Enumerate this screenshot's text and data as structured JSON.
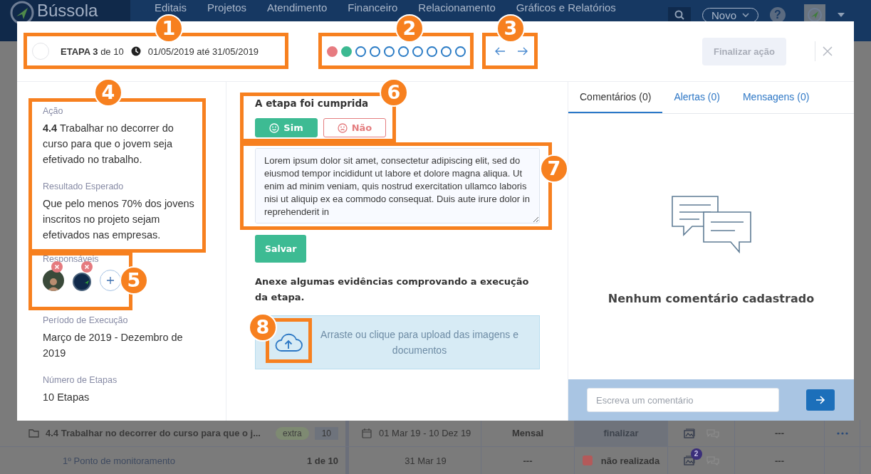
{
  "app": {
    "logo": "Bússola",
    "nav": [
      "Editais",
      "Projetos",
      "Atendimento",
      "Financeiro",
      "Relacionamento",
      "Gráficos e Relatórios"
    ],
    "new_button": "Novo",
    "help": "?"
  },
  "modal": {
    "header": {
      "done": false,
      "stage": "ETAPA 3",
      "of": "de 10",
      "dates": "01/05/2019 até 31/05/2019",
      "steps": [
        {
          "filled": true,
          "color": "#e77b80"
        },
        {
          "filled": true,
          "color": "#3cb991"
        },
        {
          "filled": false,
          "color": "#2a7bc5"
        },
        {
          "filled": false,
          "color": "#2a7bc5"
        },
        {
          "filled": false,
          "color": "#2a7bc5"
        },
        {
          "filled": false,
          "color": "#2a7bc5"
        },
        {
          "filled": false,
          "color": "#2a7bc5"
        },
        {
          "filled": false,
          "color": "#2a7bc5"
        },
        {
          "filled": false,
          "color": "#2a7bc5"
        },
        {
          "filled": false,
          "color": "#2a7bc5"
        }
      ],
      "finish_button": {
        "label": "Finalizar ação",
        "disabled": true
      }
    },
    "sections": [
      {
        "kind": "text",
        "label": "Ação",
        "value": "**4.4** Trabalhar no decorrer do curso para que o jovem seja efetivado no trabalho."
      },
      {
        "kind": "text",
        "label": "Resultado Esperado",
        "value": "Que pelo menos 70% dos jovens inscritos no projeto sejam efetivados nas empresas."
      },
      {
        "kind": "people",
        "label": "Responsáveis",
        "avatars": [
          {
            "kind": "photo"
          },
          {
            "kind": "logo"
          }
        ]
      },
      {
        "kind": "text",
        "label": "Período de Execução",
        "value": "Março de 2019 - Dezembro de 2019"
      },
      {
        "kind": "text",
        "label": "Número de Etapas",
        "value": "10 Etapas"
      }
    ],
    "completion": {
      "question": "A etapa foi cumprida",
      "options": [
        {
          "kind": "yes",
          "label": "Sim",
          "selected": true
        },
        {
          "kind": "no",
          "label": "Não",
          "selected": false
        }
      ],
      "notes": "Lorem ipsum dolor sit amet, consectetur adipiscing elit, sed do eiusmod tempor incididunt ut labore et dolore magna aliqua. Ut enim ad minim veniam, quis nostrud exercitation ullamco laboris nisi ut aliquip ex ea commodo consequat. Duis aute irure dolor in reprehenderit in",
      "save_button": "Salvar"
    },
    "evidence": {
      "prompt": "Anexe algumas evidências comprovando a execução da etapa.",
      "upload_text": "Arraste ou clique para upload das imagens e documentos"
    },
    "tabs": [
      {
        "label": "Comentários (0)",
        "selected": true
      },
      {
        "label": "Alertas (0)",
        "selected": false
      },
      {
        "label": "Mensagens (0)",
        "selected": false
      }
    ],
    "empty_message": "Nenhum comentário cadastrado",
    "comment": {
      "placeholder": "Escreva um comentário"
    }
  },
  "table_rows": [
    {
      "kind": "action",
      "title": "4.4 Trabalhar no decorrer do curso para que o j...",
      "tag": "extra",
      "count": "10",
      "period": "01 Mar 19 - 10 Dez 19",
      "frequency": "Mensal",
      "status": "finalizar",
      "notes": "---"
    },
    {
      "kind": "checkpoint",
      "title": "1º Ponto de monitoramento",
      "count": "1 de 10",
      "period": "31 Mar 19",
      "frequency": "---",
      "status": "não realizada",
      "color": "#b35a5a",
      "attachments": "2",
      "notes": "---"
    }
  ],
  "annotations": [
    "1",
    "2",
    "3",
    "4",
    "5",
    "6",
    "7",
    "8"
  ]
}
